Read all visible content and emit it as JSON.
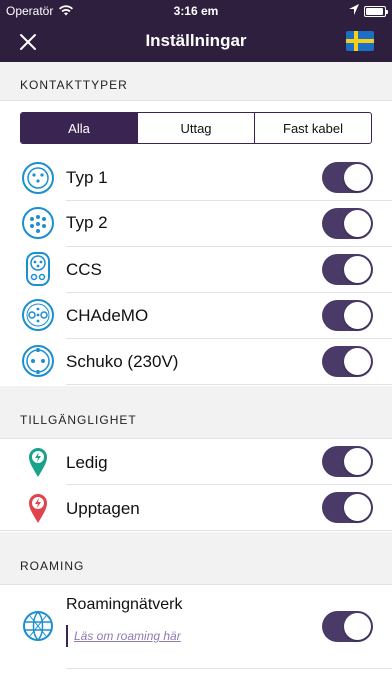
{
  "status_bar": {
    "carrier": "Operatör",
    "time": "3:16 em"
  },
  "nav": {
    "title": "Inställningar",
    "close_icon": "close-icon",
    "flag_icon": "swedish-flag-icon"
  },
  "sections": {
    "connectors": {
      "header": "KONTAKTTYPER",
      "segments": [
        "Alla",
        "Uttag",
        "Fast kabel"
      ],
      "selected_segment": "Alla",
      "items": [
        {
          "label": "Typ 1",
          "icon": "type1-connector-icon",
          "enabled": true
        },
        {
          "label": "Typ 2",
          "icon": "type2-connector-icon",
          "enabled": true
        },
        {
          "label": "CCS",
          "icon": "ccs-connector-icon",
          "enabled": true
        },
        {
          "label": "CHAdeMO",
          "icon": "chademo-connector-icon",
          "enabled": true
        },
        {
          "label": "Schuko (230V)",
          "icon": "schuko-connector-icon",
          "enabled": true
        }
      ]
    },
    "availability": {
      "header": "TILLGÄNGLIGHET",
      "items": [
        {
          "label": "Ledig",
          "icon": "available-pin-icon",
          "enabled": true
        },
        {
          "label": "Upptagen",
          "icon": "occupied-pin-icon",
          "enabled": true
        }
      ]
    },
    "roaming": {
      "header": "ROAMING",
      "item": {
        "label": "Roamingnätverk",
        "icon": "globe-icon",
        "enabled": true,
        "link": "Läs om roaming här"
      }
    }
  },
  "colors": {
    "nav_bg": "#2f1f3f",
    "accent": "#3a2552",
    "toggle_on": "#4a3a68",
    "icon_blue": "#1b8fd0",
    "pin_green": "#1aa28a",
    "pin_red": "#e0434b"
  }
}
